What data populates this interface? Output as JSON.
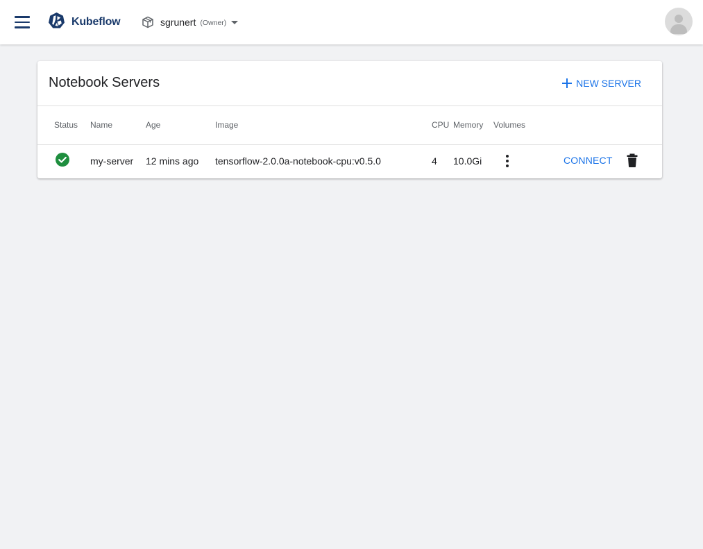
{
  "header": {
    "menu_icon": "menu-icon",
    "logo_icon": "kubeflow-logo-icon",
    "app_name": "Kubeflow",
    "namespace": {
      "icon": "box-icon",
      "name": "sgrunert",
      "role": "(Owner)"
    },
    "avatar_icon": "account-avatar-icon"
  },
  "notebook_servers": {
    "title": "Notebook Servers",
    "new_button_label": "NEW SERVER",
    "columns": [
      "Status",
      "Name",
      "Age",
      "Image",
      "CPU",
      "Memory",
      "Volumes"
    ],
    "rows": [
      {
        "status": "running",
        "status_icon": "check-circle-icon",
        "name": "my-server",
        "age": "12 mins ago",
        "image": "tensorflow-2.0.0a-notebook-cpu:v0.5.0",
        "cpu": "4",
        "memory": "10.0Gi",
        "volumes_icon": "more-vert-icon",
        "connect_label": "CONNECT",
        "delete_icon": "delete-icon"
      }
    ]
  },
  "colors": {
    "accent": "#1a73e8",
    "brand": "#1a3a6b",
    "success": "#1e8e3e",
    "background": "#f1f2f4"
  }
}
